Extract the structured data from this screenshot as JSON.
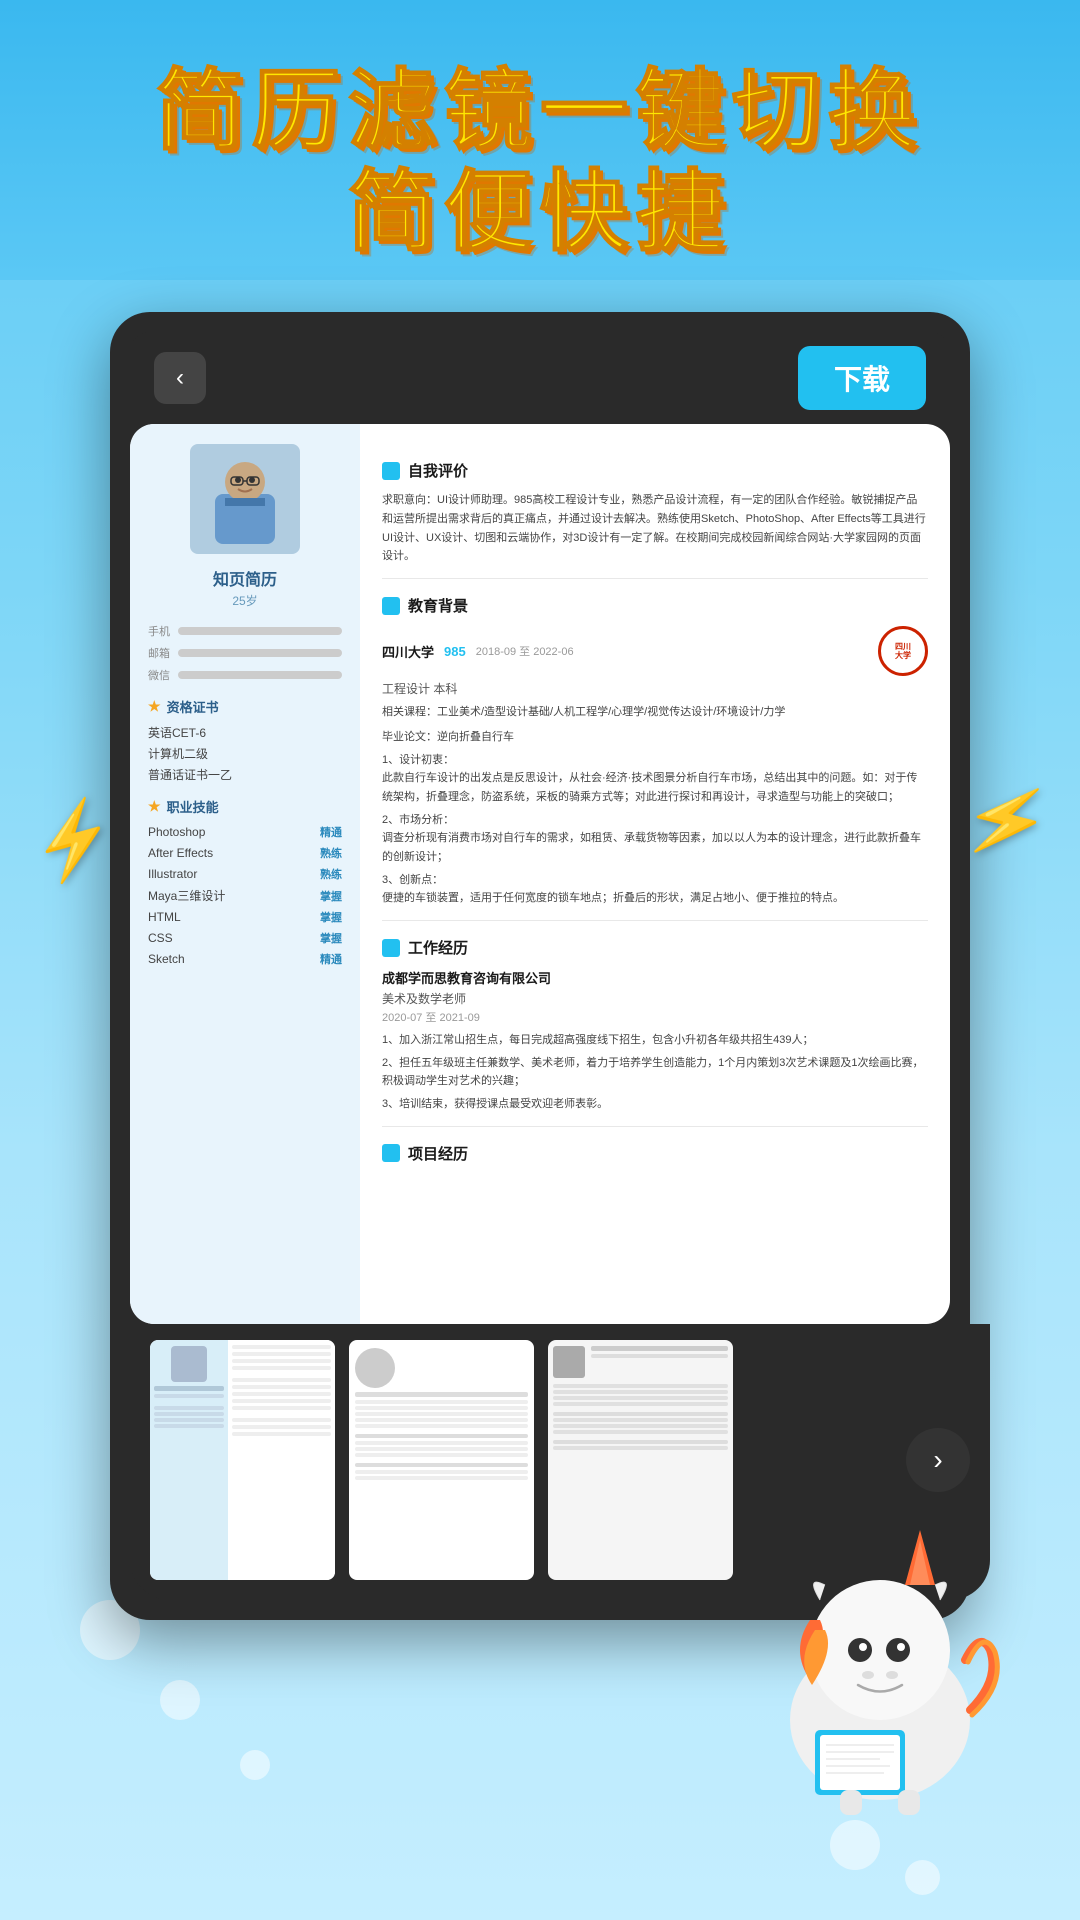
{
  "hero": {
    "line1": "简历滤镜一键切换",
    "line2": "简便快捷"
  },
  "device": {
    "back_label": "‹",
    "download_label": "下载"
  },
  "resume": {
    "profile": {
      "name": "知页简历",
      "age": "25岁",
      "contact_labels": [
        "手机",
        "邮箱",
        "微信"
      ]
    },
    "certs_title": "资格证书",
    "certs": [
      "英语CET-6",
      "计算机二级",
      "普通话证书一乙"
    ],
    "skills_title": "职业技能",
    "skills": [
      {
        "name": "Photoshop",
        "level": "精通"
      },
      {
        "name": "After Effects",
        "level": "熟练"
      },
      {
        "name": "Illustrator",
        "level": "熟练"
      },
      {
        "name": "Maya三维设计",
        "level": "掌握"
      },
      {
        "name": "HTML",
        "level": "掌握"
      },
      {
        "name": "CSS",
        "level": "掌握"
      },
      {
        "name": "Sketch",
        "level": "精通"
      }
    ],
    "self_eval_title": "自我评价",
    "self_eval": "求职意向：UI设计师助理。985高校工程设计专业，熟悉产品设计流程，有一定的团队合作经验。敏锐捕捉产品和运营所提出需求背后的真正痛点，并通过设计去解决。熟练使用Sketch、PhotoShop、After Effects等工具进行UI设计、UX设计、切图和云端协作，对3D设计有一定了解。在校期间完成校园新闻综合网站·大学家园网的页面设计。",
    "edu_title": "教育背景",
    "edu_school": "四川大学",
    "edu_score": "985",
    "edu_period": "2018-09 至 2022-06",
    "edu_degree": "工程设计  本科",
    "edu_courses": "相关课程：工业美术/造型设计基础/人机工程学/心理学/视觉传达设计/环境设计/力学",
    "thesis": "毕业论文：逆向折叠自行车",
    "thesis_points": [
      "1、设计初衷：\n此款自行车设计的出发点是反思设计，从社会·经济·技术图景分析自行车市场，总结出其中的问题。如：对于传统架构，折叠理念，防盗系统，采板的骑乘方式等；对此进行探讨和再设计，寻求造型与功能上的突破口；",
      "2、市场分析：\n调查分析现有消费市场对自行车的需求，如租赁、承载货物等因素，加以以人为本的设计理念，进行此款折叠车的创新设计；",
      "3、创新点：\n便捷的车锁装置，适用于任何宽度的锁车地点；折叠后的形状，满足占地小、便于推拉的特点。"
    ],
    "work_title": "工作经历",
    "work_company": "成都学而思教育咨询有限公司",
    "work_position": "美术及数学老师",
    "work_period": "2020-07 至 2021-09",
    "work_points": [
      "1、加入浙江常山招生点，每日完成超高强度线下招生，包含小升初各年级共招生439人；",
      "2、担任五年级班主任兼数学、美术老师，着力于培养学生创造能力，1个月内策划3次艺术课题及1次绘画比赛，积极调动学生对艺术的兴趣；",
      "3、培训结束，获得授课点最受欢迎老师表彰。"
    ],
    "project_title": "项目经历"
  },
  "carousel": {
    "next_icon": "›",
    "thumbs": [
      {
        "id": 1,
        "style": "light-blue"
      },
      {
        "id": 2,
        "style": "white"
      },
      {
        "id": 3,
        "style": "light-gray"
      }
    ]
  }
}
